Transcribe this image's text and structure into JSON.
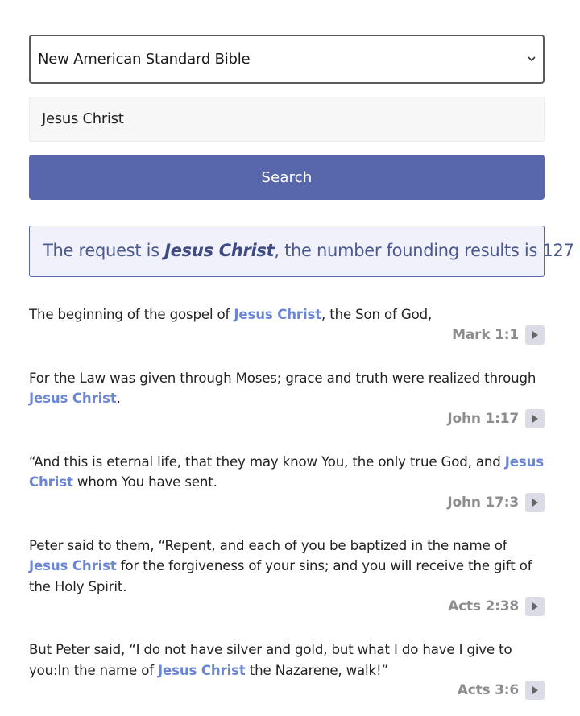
{
  "select": {
    "value": "New American Standard Bible"
  },
  "search": {
    "value": "Jesus Christ",
    "button_label": "Search"
  },
  "info": {
    "prefix": "The request is ",
    "query": "Jesus Christ",
    "suffix": ", the number founding results is 127"
  },
  "results": [
    {
      "before": "The beginning of the gospel of ",
      "highlight": "Jesus Christ",
      "after": ", the Son of God,",
      "ref": "Mark 1:1"
    },
    {
      "before": "For the Law was given through Moses; grace and truth were realized through ",
      "highlight": "Jesus Christ",
      "after": ".",
      "ref": "John 1:17"
    },
    {
      "before": "“And this is eternal life, that they may know You, the only true God, and ",
      "highlight": "Jesus Christ",
      "after": " whom You have sent.",
      "ref": "John 17:3"
    },
    {
      "before": "Peter said to them, “Repent, and each of you be baptized in the name of ",
      "highlight": "Jesus Christ",
      "after": " for the forgiveness of your sins; and you will receive the gift of the Holy Spirit.",
      "ref": "Acts 2:38"
    },
    {
      "before": "But Peter said, “I do not have silver and gold, but what I do have I give to you:In the name of ",
      "highlight": "Jesus Christ",
      "after": " the Nazarene, walk!”",
      "ref": "Acts 3:6"
    }
  ],
  "icons": {
    "select_chevron": "chevron-down-icon",
    "play": "play-icon"
  },
  "colors": {
    "button": "#5866ab",
    "highlight": "#6a86d6",
    "info_bg": "#f1f1fc",
    "info_text": "#4b5a8f",
    "ref": "#8d8d8d"
  }
}
